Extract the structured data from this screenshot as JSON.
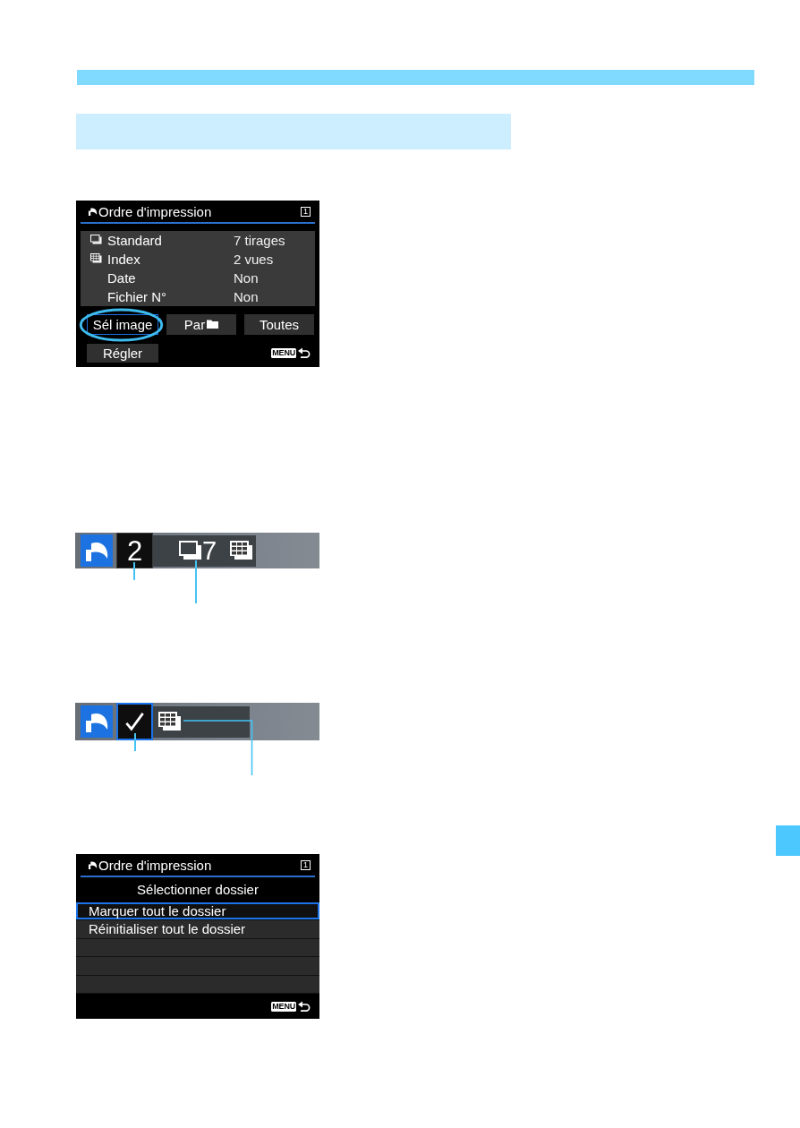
{
  "print_order_screen": {
    "title": "Ordre d'impression",
    "tab": "1",
    "settings": [
      {
        "kind": "standard",
        "label": "Standard",
        "value": "7 tirages"
      },
      {
        "kind": "index",
        "label": "Index",
        "value": "2 vues"
      },
      {
        "kind": "plain",
        "label": "Date",
        "value": "Non"
      },
      {
        "kind": "plain",
        "label": "Fichier N°",
        "value": "Non"
      }
    ],
    "button_rows": [
      [
        {
          "kind": "text",
          "label": "Sél image",
          "selected": true,
          "circled": true
        },
        {
          "kind": "folder",
          "label": "Par",
          "selected": false,
          "circled": false
        },
        {
          "kind": "text",
          "label": "Toutes",
          "selected": false,
          "circled": false
        }
      ],
      [
        {
          "kind": "text",
          "label": "Régler",
          "selected": false,
          "circled": false
        }
      ]
    ],
    "menu_key": "MENU"
  },
  "status_strips": [
    {
      "kind": "number",
      "selected": false,
      "count": "2",
      "tile_callout": true,
      "standard_count": "7",
      "standard_callout": true,
      "index_callout": false
    },
    {
      "kind": "check",
      "selected": true,
      "tile_callout": true,
      "index_callout": true
    }
  ],
  "folder_screen": {
    "title": "Ordre d'impression",
    "tab": "1",
    "subtitle": "Sélectionner dossier",
    "options": [
      {
        "label": "Marquer tout le dossier",
        "selected": true
      },
      {
        "label": "Réinitialiser tout le dossier",
        "selected": false
      }
    ],
    "menu_key": "MENU"
  }
}
